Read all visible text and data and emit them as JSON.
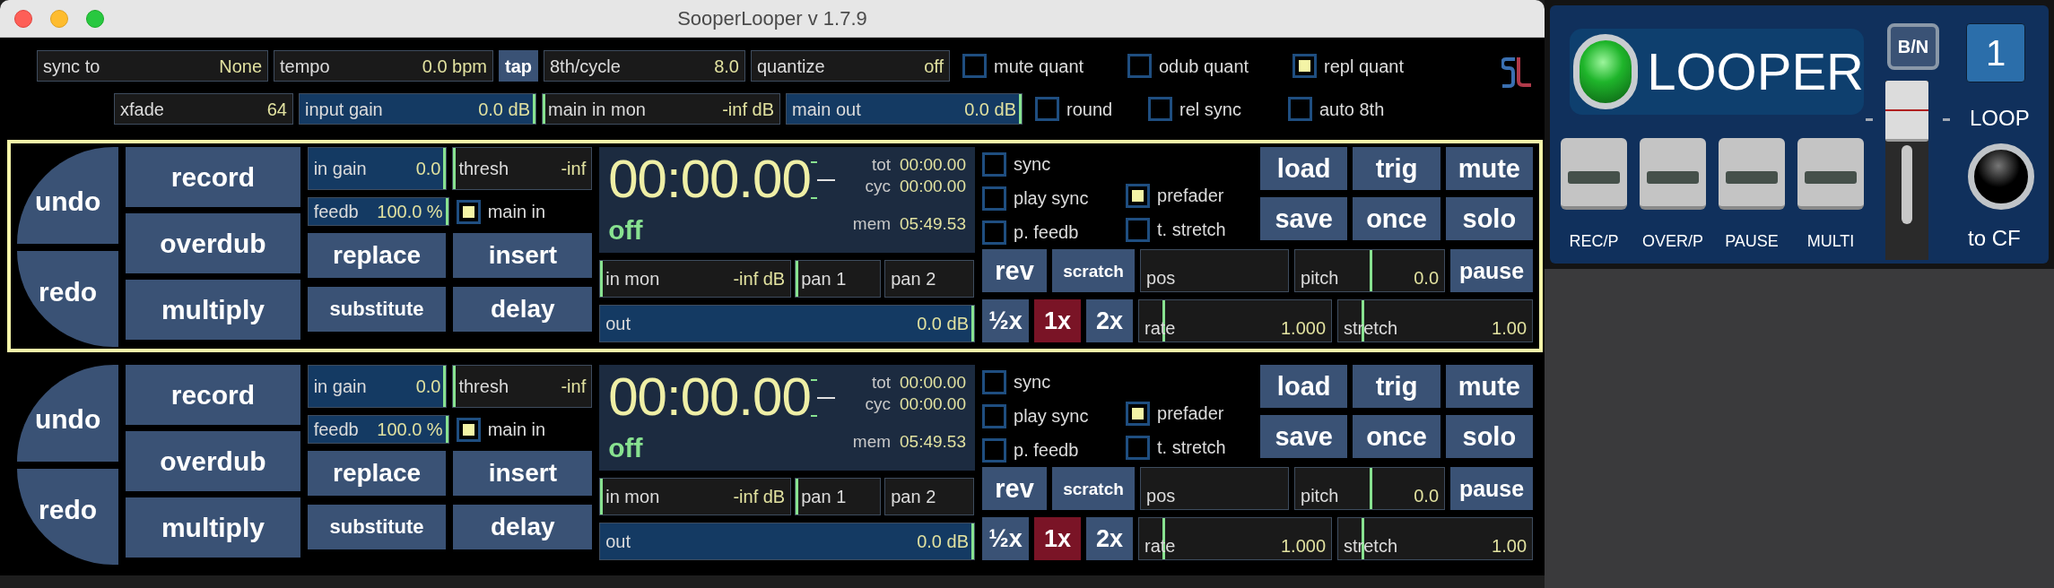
{
  "window": {
    "title": "SooperLooper v 1.7.9"
  },
  "globals": {
    "row_1": [
      {
        "kind": "value_field",
        "label": "sync to",
        "value": "None"
      },
      {
        "kind": "value_field",
        "label": "tempo",
        "value": "0.0 bpm"
      },
      {
        "kind": "button",
        "label": "tap"
      },
      {
        "kind": "value_field",
        "label": "8th/cycle",
        "value": "8.0"
      },
      {
        "kind": "value_field",
        "label": "quantize",
        "value": "off"
      },
      {
        "kind": "checkbox",
        "label": "mute quant",
        "checked": false
      },
      {
        "kind": "checkbox",
        "label": "odub quant",
        "checked": false
      },
      {
        "kind": "checkbox",
        "label": "repl quant",
        "checked": true
      }
    ],
    "row_2": [
      {
        "kind": "value_field",
        "label": "xfade",
        "value": "64"
      },
      {
        "kind": "fill_slider",
        "label": "input gain",
        "value": "0.0 dB",
        "level": 1
      },
      {
        "kind": "fill_slider",
        "label": "main in mon",
        "value": "-inf dB",
        "level": 0
      },
      {
        "kind": "fill_slider",
        "label": "main out",
        "value": "0.0 dB",
        "level": 1
      },
      {
        "kind": "checkbox",
        "label": "round",
        "checked": false
      },
      {
        "kind": "checkbox",
        "label": "rel sync",
        "checked": false
      },
      {
        "kind": "checkbox",
        "label": "auto 8th",
        "checked": false
      }
    ]
  },
  "loops": [
    {
      "selected": true,
      "undo": "undo",
      "redo": "redo",
      "mode_buttons": [
        "record",
        "overdub",
        "multiply"
      ],
      "gain_fields": [
        {
          "kind": "fill_slider",
          "label": "in gain",
          "value": "0.0",
          "level": 1
        },
        {
          "kind": "fill_slider",
          "label": "thresh",
          "value": "-inf",
          "level": 0
        }
      ],
      "feedback": {
        "kind": "fill_slider",
        "label": "feedb",
        "value": "100.0 %",
        "level": 1
      },
      "main_in": {
        "label": "main in",
        "checked": true
      },
      "edit_buttons": [
        "replace",
        "insert",
        "substitute",
        "delay"
      ],
      "time": "00:00.00",
      "state": "off",
      "stats": [
        {
          "label": "tot",
          "value": "00:00.00"
        },
        {
          "label": "cyc",
          "value": "00:00.00"
        },
        {
          "label": "mem",
          "value": "05:49.53"
        }
      ],
      "monitor": [
        {
          "kind": "fill_slider",
          "label": "in mon",
          "value": "-inf dB",
          "level": 0
        },
        {
          "kind": "fill_slider",
          "label": "pan 1",
          "level": 0
        },
        {
          "kind": "value_field",
          "label": "pan 2"
        }
      ],
      "out": {
        "kind": "fill_slider",
        "label": "out",
        "value": "0.0 dB",
        "level": 1
      },
      "options_left": [
        {
          "label": "sync",
          "checked": false
        },
        {
          "label": "play sync",
          "checked": false
        },
        {
          "label": "p. feedb",
          "checked": false
        }
      ],
      "options_right": [
        {
          "label": "prefader",
          "checked": true
        },
        {
          "label": "t. stretch",
          "checked": false
        }
      ],
      "actions": [
        "load",
        "trig",
        "mute",
        "save",
        "once",
        "solo"
      ],
      "rev": "rev",
      "scratch": "scratch",
      "pos": {
        "kind": "value_field",
        "label": "pos"
      },
      "pitch": {
        "kind": "marker_slider",
        "label": "pitch",
        "value": "0.0",
        "level": 0.5
      },
      "pause": "pause",
      "rates": [
        {
          "label": "½x",
          "selected": false
        },
        {
          "label": "1x",
          "selected": true
        },
        {
          "label": "2x",
          "selected": false
        }
      ],
      "rate": {
        "kind": "marker_slider",
        "label": "rate",
        "value": "1.000",
        "level": 0.12
      },
      "stretch": {
        "kind": "marker_slider",
        "label": "stretch",
        "value": "1.00",
        "level": 0.12
      }
    },
    {
      "selected": false,
      "undo": "undo",
      "redo": "redo",
      "mode_buttons": [
        "record",
        "overdub",
        "multiply"
      ],
      "gain_fields": [
        {
          "kind": "fill_slider",
          "label": "in gain",
          "value": "0.0",
          "level": 1
        },
        {
          "kind": "fill_slider",
          "label": "thresh",
          "value": "-inf",
          "level": 0
        }
      ],
      "feedback": {
        "kind": "fill_slider",
        "label": "feedb",
        "value": "100.0 %",
        "level": 1
      },
      "main_in": {
        "label": "main in",
        "checked": true
      },
      "edit_buttons": [
        "replace",
        "insert",
        "substitute",
        "delay"
      ],
      "time": "00:00.00",
      "state": "off",
      "stats": [
        {
          "label": "tot",
          "value": "00:00.00"
        },
        {
          "label": "cyc",
          "value": "00:00.00"
        },
        {
          "label": "mem",
          "value": "05:49.53"
        }
      ],
      "monitor": [
        {
          "kind": "fill_slider",
          "label": "in mon",
          "value": "-inf dB",
          "level": 0
        },
        {
          "kind": "fill_slider",
          "label": "pan 1",
          "level": 0
        },
        {
          "kind": "value_field",
          "label": "pan 2"
        }
      ],
      "out": {
        "kind": "fill_slider",
        "label": "out",
        "value": "0.0 dB",
        "level": 1
      },
      "options_left": [
        {
          "label": "sync",
          "checked": false
        },
        {
          "label": "play sync",
          "checked": false
        },
        {
          "label": "p. feedb",
          "checked": false
        }
      ],
      "options_right": [
        {
          "label": "prefader",
          "checked": true
        },
        {
          "label": "t. stretch",
          "checked": false
        }
      ],
      "actions": [
        "load",
        "trig",
        "mute",
        "save",
        "once",
        "solo"
      ],
      "rev": "rev",
      "scratch": "scratch",
      "pos": {
        "kind": "value_field",
        "label": "pos"
      },
      "pitch": {
        "kind": "marker_slider",
        "label": "pitch",
        "value": "0.0",
        "level": 0.5
      },
      "pause": "pause",
      "rates": [
        {
          "label": "½x",
          "selected": false
        },
        {
          "label": "1x",
          "selected": true
        },
        {
          "label": "2x",
          "selected": false
        }
      ],
      "rate": {
        "kind": "marker_slider",
        "label": "rate",
        "value": "1.000",
        "level": 0.12
      },
      "stretch": {
        "kind": "marker_slider",
        "label": "stretch",
        "value": "1.00",
        "level": 0.12
      }
    }
  ],
  "looper_panel": {
    "title": "LOOPER",
    "bn_button": "B/N",
    "loop_number": "1",
    "loop_label": "LOOP",
    "pedals": [
      "REC/P",
      "OVER/P",
      "PAUSE",
      "MULTI"
    ],
    "jack_label": "to CF"
  }
}
